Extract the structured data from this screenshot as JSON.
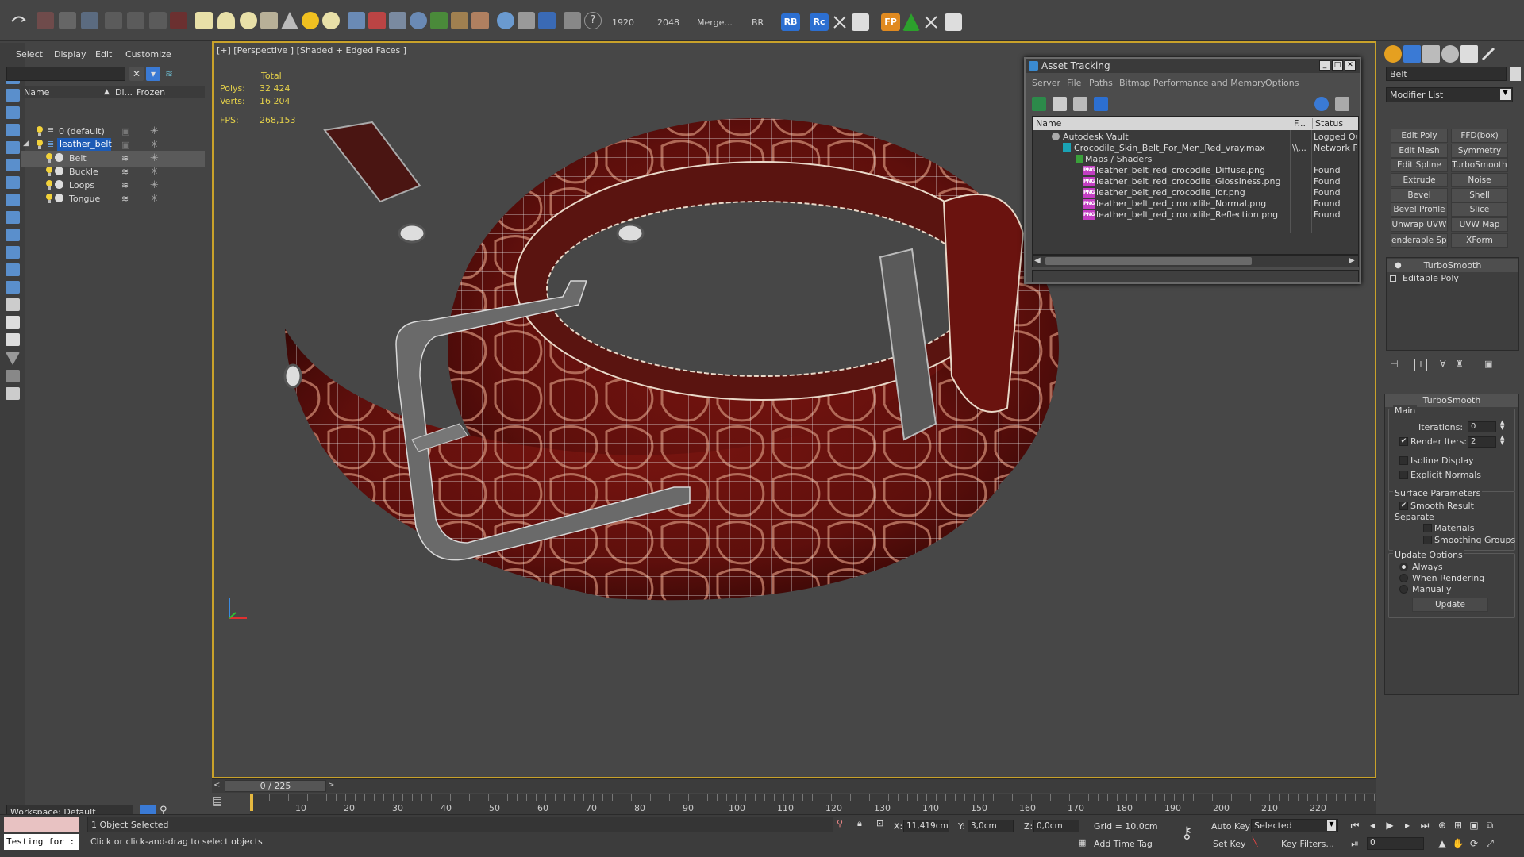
{
  "toolbar": {
    "render_width": "1920",
    "render_height": "2048",
    "merge_label": "Merge...",
    "br_label": "BR",
    "rb_badge": "RB",
    "rc_badge": "Rc",
    "fp_badge": "FP"
  },
  "scene_explorer": {
    "menu": [
      "Select",
      "Display",
      "Edit",
      "Customize"
    ],
    "columns": {
      "name": "Name",
      "display": "Di...",
      "frozen": "Frozen"
    },
    "rows": [
      {
        "name": "0 (default)"
      },
      {
        "name": "leather_belt"
      },
      {
        "name": "Belt"
      },
      {
        "name": "Buckle"
      },
      {
        "name": "Loops"
      },
      {
        "name": "Tongue"
      }
    ],
    "workspace": "Workspace: Default"
  },
  "viewport": {
    "label": "[+] [Perspective ] [Shaded + Edged Faces ]",
    "stats": {
      "header": "Total",
      "polys_label": "Polys:",
      "polys": "32 424",
      "verts_label": "Verts:",
      "verts": "16 204",
      "fps_label": "FPS:",
      "fps": "268,153"
    }
  },
  "asset_tracking": {
    "title": "Asset Tracking",
    "menu": [
      "Server",
      "File",
      "Paths",
      "Bitmap Performance and Memory",
      "Options"
    ],
    "columns": {
      "name": "Name",
      "f": "F...",
      "status": "Status"
    },
    "rows": [
      {
        "name": "Autodesk Vault",
        "f": "",
        "status": "Logged Ou"
      },
      {
        "name": "Crocodile_Skin_Belt_For_Men_Red_vray.max",
        "f": "\\\\...",
        "status": "Network Pa"
      },
      {
        "name": "Maps / Shaders",
        "f": "",
        "status": ""
      },
      {
        "name": "leather_belt_red_crocodile_Diffuse.png",
        "f": "",
        "status": "Found"
      },
      {
        "name": "leather_belt_red_crocodile_Glossiness.png",
        "f": "",
        "status": "Found"
      },
      {
        "name": "leather_belt_red_crocodile_ior.png",
        "f": "",
        "status": "Found"
      },
      {
        "name": "leather_belt_red_crocodile_Normal.png",
        "f": "",
        "status": "Found"
      },
      {
        "name": "leather_belt_red_crocodile_Reflection.png",
        "f": "",
        "status": "Found"
      }
    ],
    "png_badge": "PNG"
  },
  "command_panel": {
    "object_name": "Belt",
    "modifier_list": "Modifier List",
    "buttons": [
      "Edit Poly",
      "FFD(box)",
      "Edit Mesh",
      "Symmetry",
      "Edit Spline",
      "TurboSmooth",
      "Extrude",
      "Noise",
      "Bevel",
      "Shell",
      "Bevel Profile",
      "Slice",
      "Unwrap UVW",
      "UVW Map",
      "enderable Splir",
      "XForm"
    ],
    "stack": [
      "TurboSmooth",
      "Editable Poly"
    ],
    "rollout": {
      "title": "TurboSmooth",
      "main": "Main",
      "iterations_label": "Iterations:",
      "iterations": "0",
      "render_iters_label": "Render Iters:",
      "render_iters": "2",
      "isoline": "Isoline Display",
      "explicit_normals": "Explicit Normals",
      "surface_params": "Surface Parameters",
      "smooth_result": "Smooth Result",
      "separate": "Separate",
      "materials": "Materials",
      "smoothing_groups": "Smoothing Groups",
      "update_options": "Update Options",
      "always": "Always",
      "when_rendering": "When Rendering",
      "manually": "Manually",
      "update_button": "Update"
    }
  },
  "timeline": {
    "slider": "0 / 225",
    "ticks": [
      "10",
      "20",
      "30",
      "40",
      "50",
      "60",
      "70",
      "80",
      "90",
      "100",
      "110",
      "120",
      "130",
      "140",
      "150",
      "160",
      "170",
      "180",
      "190",
      "200",
      "210",
      "220"
    ]
  },
  "status_bar": {
    "maxscript_text": "Testing for :",
    "selection": "1 Object Selected",
    "prompt": "Click or click-and-drag to select objects",
    "x_label": "X:",
    "x": "11,419cm",
    "y_label": "Y:",
    "y": "3,0cm",
    "z_label": "Z:",
    "z": "0,0cm",
    "grid": "Grid = 10,0cm",
    "add_time_tag": "Add Time Tag",
    "auto_key": "Auto Key",
    "set_key": "Set Key",
    "selected": "Selected",
    "key_filters": "Key Filters...",
    "frame": "0"
  }
}
